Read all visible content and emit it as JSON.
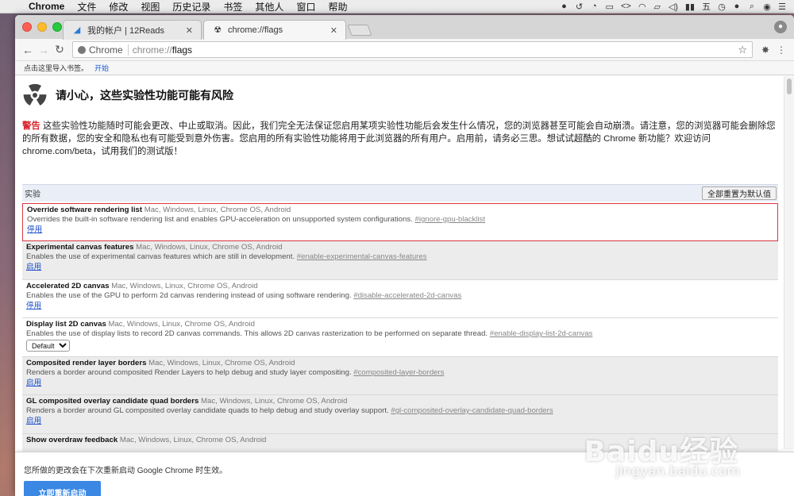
{
  "menubar": {
    "items": [
      "Chrome",
      "文件",
      "修改",
      "视图",
      "历史记录",
      "书签",
      "其他人",
      "窗口",
      "帮助"
    ]
  },
  "tabs": [
    {
      "title": "我的帐户 | 12Reads",
      "active": false
    },
    {
      "title": "chrome://flags",
      "active": true
    }
  ],
  "omnibox": {
    "chip": "Chrome",
    "scheme": "chrome://",
    "path": "flags"
  },
  "bookmarks": {
    "hint": "点击这里导入书签。",
    "link": "开始"
  },
  "page": {
    "title": "请小心，这些实验性功能可能有风险",
    "warning_label": "警告",
    "warning_text": "这些实验性功能随时可能会更改、中止或取消。因此，我们完全无法保证您启用某项实验性功能后会发生什么情况，您的浏览器甚至可能会自动崩溃。请注意，您的浏览器可能会删除您的所有数据，您的安全和隐私也有可能受到意外伤害。您启用的所有实验性功能将用于此浏览器的所有用户。启用前，请务必三思。想试试超酷的 Chrome 新功能？欢迎访问 chrome.com/beta，试用我们的测试版！",
    "experiments_header": "实验",
    "reset_button": "全部重置为默认值"
  },
  "flags": [
    {
      "name": "Override software rendering list",
      "platforms": "Mac, Windows, Linux, Chrome OS, Android",
      "desc": "Overrides the built-in software rendering list and enables GPU-acceleration on unsupported system configurations.",
      "anchor": "#ignore-gpu-blacklist",
      "action": "停用",
      "kind": "link",
      "highlight": true,
      "disabled": false
    },
    {
      "name": "Experimental canvas features",
      "platforms": "Mac, Windows, Linux, Chrome OS, Android",
      "desc": "Enables the use of experimental canvas features which are still in development.",
      "anchor": "#enable-experimental-canvas-features",
      "action": "启用",
      "kind": "link",
      "highlight": false,
      "disabled": true
    },
    {
      "name": "Accelerated 2D canvas",
      "platforms": "Mac, Windows, Linux, Chrome OS, Android",
      "desc": "Enables the use of the GPU to perform 2d canvas rendering instead of using software rendering.",
      "anchor": "#disable-accelerated-2d-canvas",
      "action": "停用",
      "kind": "link",
      "highlight": false,
      "disabled": false
    },
    {
      "name": "Display list 2D canvas",
      "platforms": "Mac, Windows, Linux, Chrome OS, Android",
      "desc": "Enables the use of display lists to record 2D canvas commands. This allows 2D canvas rasterization to be performed on separate thread.",
      "anchor": "#enable-display-list-2d-canvas",
      "action": "Default",
      "kind": "select",
      "highlight": false,
      "disabled": false
    },
    {
      "name": "Composited render layer borders",
      "platforms": "Mac, Windows, Linux, Chrome OS, Android",
      "desc": "Renders a border around composited Render Layers to help debug and study layer compositing.",
      "anchor": "#composited-layer-borders",
      "action": "启用",
      "kind": "link",
      "highlight": false,
      "disabled": true
    },
    {
      "name": "GL composited overlay candidate quad borders",
      "platforms": "Mac, Windows, Linux, Chrome OS, Android",
      "desc": "Renders a border around GL composited overlay candidate quads to help debug and study overlay support.",
      "anchor": "#gl-composited-overlay-candidate-quad-borders",
      "action": "启用",
      "kind": "link",
      "highlight": false,
      "disabled": true
    },
    {
      "name": "Show overdraw feedback",
      "platforms": "Mac, Windows, Linux, Chrome OS, Android",
      "desc": "",
      "anchor": "",
      "action": "",
      "kind": "link",
      "highlight": false,
      "disabled": true
    }
  ],
  "footer": {
    "message": "您所做的更改会在下次重新启动 Google Chrome 时生效。",
    "relaunch_button": "立即重新启动"
  },
  "watermark": {
    "brand": "Baidu经验",
    "url": "jingyan.baidu.com"
  }
}
